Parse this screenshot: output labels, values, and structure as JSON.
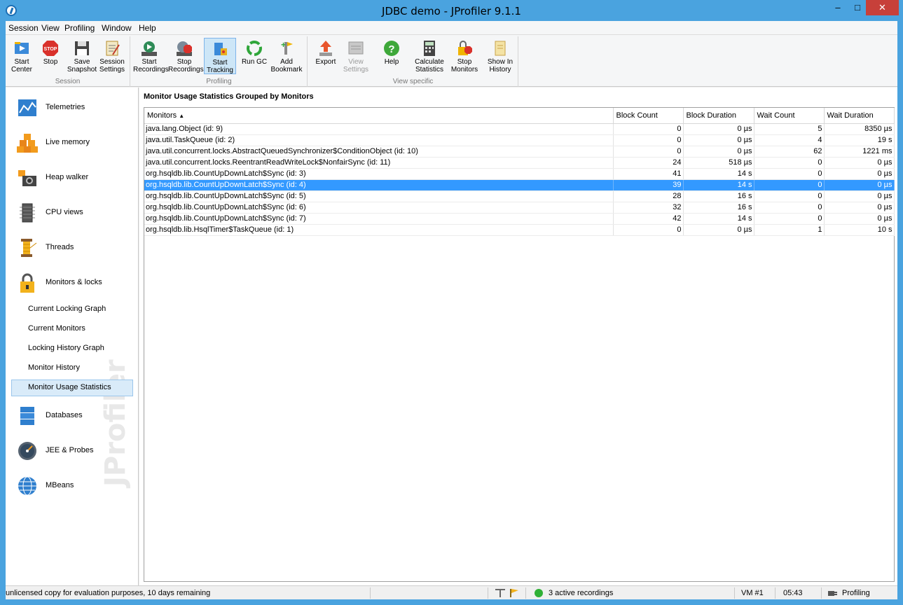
{
  "window": {
    "title": "JDBC demo - JProfiler 9.1.1"
  },
  "menu": [
    "Session",
    "View",
    "Profiling",
    "Window",
    "Help"
  ],
  "toolbar": {
    "groups": {
      "session": "Session",
      "profiling": "Profiling",
      "view_specific": "View specific"
    },
    "buttons": {
      "start_center": "Start Center",
      "stop": "Stop",
      "save_snapshot": "Save Snapshot",
      "session_settings": "Session Settings",
      "start_recordings": "Start Recordings",
      "stop_recordings": "Stop Recordings",
      "start_tracking": "Start Tracking",
      "run_gc": "Run GC",
      "add_bookmark": "Add Bookmark",
      "export": "Export",
      "view_settings": "View Settings",
      "help": "Help",
      "calculate_statistics": "Calculate Statistics",
      "stop_monitors": "Stop Monitors",
      "show_in_history": "Show In History"
    }
  },
  "sidebar": {
    "items": {
      "telemetries": "Telemetries",
      "live_memory": "Live memory",
      "heap_walker": "Heap walker",
      "cpu_views": "CPU views",
      "threads": "Threads",
      "monitors_locks": "Monitors & locks",
      "databases": "Databases",
      "jee_probes": "JEE & Probes",
      "mbeans": "MBeans"
    },
    "subitems": {
      "current_locking_graph": "Current Locking Graph",
      "current_monitors": "Current Monitors",
      "locking_history_graph": "Locking History Graph",
      "monitor_history": "Monitor History",
      "monitor_usage_statistics": "Monitor Usage Statistics"
    },
    "selected": "Monitor Usage Statistics",
    "watermark": "JProfiler"
  },
  "main": {
    "title": "Monitor Usage Statistics Grouped by Monitors",
    "columns": [
      "Monitors",
      "Block Count",
      "Block Duration",
      "Wait Count",
      "Wait Duration"
    ],
    "sort_indicator": "▲",
    "rows": [
      [
        "java.lang.Object (id: 9)",
        "0",
        "0 µs",
        "5",
        "8350 µs"
      ],
      [
        "java.util.TaskQueue (id: 2)",
        "0",
        "0 µs",
        "4",
        "19 s"
      ],
      [
        "java.util.concurrent.locks.AbstractQueuedSynchronizer$ConditionObject (id: 10)",
        "0",
        "0 µs",
        "62",
        "1221 ms"
      ],
      [
        "java.util.concurrent.locks.ReentrantReadWriteLock$NonfairSync (id: 11)",
        "24",
        "518 µs",
        "0",
        "0 µs"
      ],
      [
        "org.hsqldb.lib.CountUpDownLatch$Sync (id: 3)",
        "41",
        "14 s",
        "0",
        "0 µs"
      ],
      [
        "org.hsqldb.lib.CountUpDownLatch$Sync (id: 4)",
        "39",
        "14 s",
        "0",
        "0 µs"
      ],
      [
        "org.hsqldb.lib.CountUpDownLatch$Sync (id: 5)",
        "28",
        "16 s",
        "0",
        "0 µs"
      ],
      [
        "org.hsqldb.lib.CountUpDownLatch$Sync (id: 6)",
        "32",
        "16 s",
        "0",
        "0 µs"
      ],
      [
        "org.hsqldb.lib.CountUpDownLatch$Sync (id: 7)",
        "42",
        "14 s",
        "0",
        "0 µs"
      ],
      [
        "org.hsqldb.lib.HsqlTimer$TaskQueue (id: 1)",
        "0",
        "0 µs",
        "1",
        "10 s"
      ]
    ],
    "selected_row": 5
  },
  "status": {
    "license": "unlicensed copy for evaluation purposes, 10 days remaining",
    "recordings": "3 active recordings",
    "vm": "VM #1",
    "time": "05:43",
    "mode": "Profiling"
  },
  "colors": {
    "titlebar": "#4aa3df",
    "selection": "#3399ff",
    "close_button": "#c7403a"
  }
}
